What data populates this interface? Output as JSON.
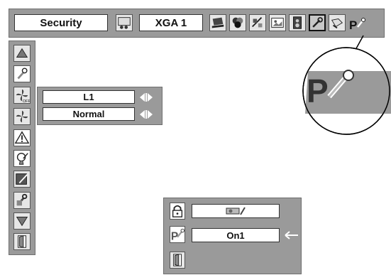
{
  "menu_bar": {
    "title": "Security",
    "source_value": "XGA 1",
    "icons": [
      "projector-source-icon",
      "laptop-input-icon",
      "color-balls-icon",
      "pc-adjust-icon",
      "image-select-icon",
      "sound-icon",
      "setting-wrench-icon",
      "expand-icon",
      "security-key-icon"
    ]
  },
  "side_menu": {
    "items": [
      "up-arrow-icon",
      "key-icon",
      "fan-off-icon",
      "fan-icon",
      "warning-icon",
      "lamp-icon",
      "screen-pen-icon",
      "wrench-pen-icon",
      "down-arrow-icon",
      "exit-door-icon"
    ]
  },
  "settings": {
    "row1_value": "L1",
    "row2_value": "Normal"
  },
  "pin_dialog": {
    "row1_value": "",
    "row2_value": "On1"
  }
}
